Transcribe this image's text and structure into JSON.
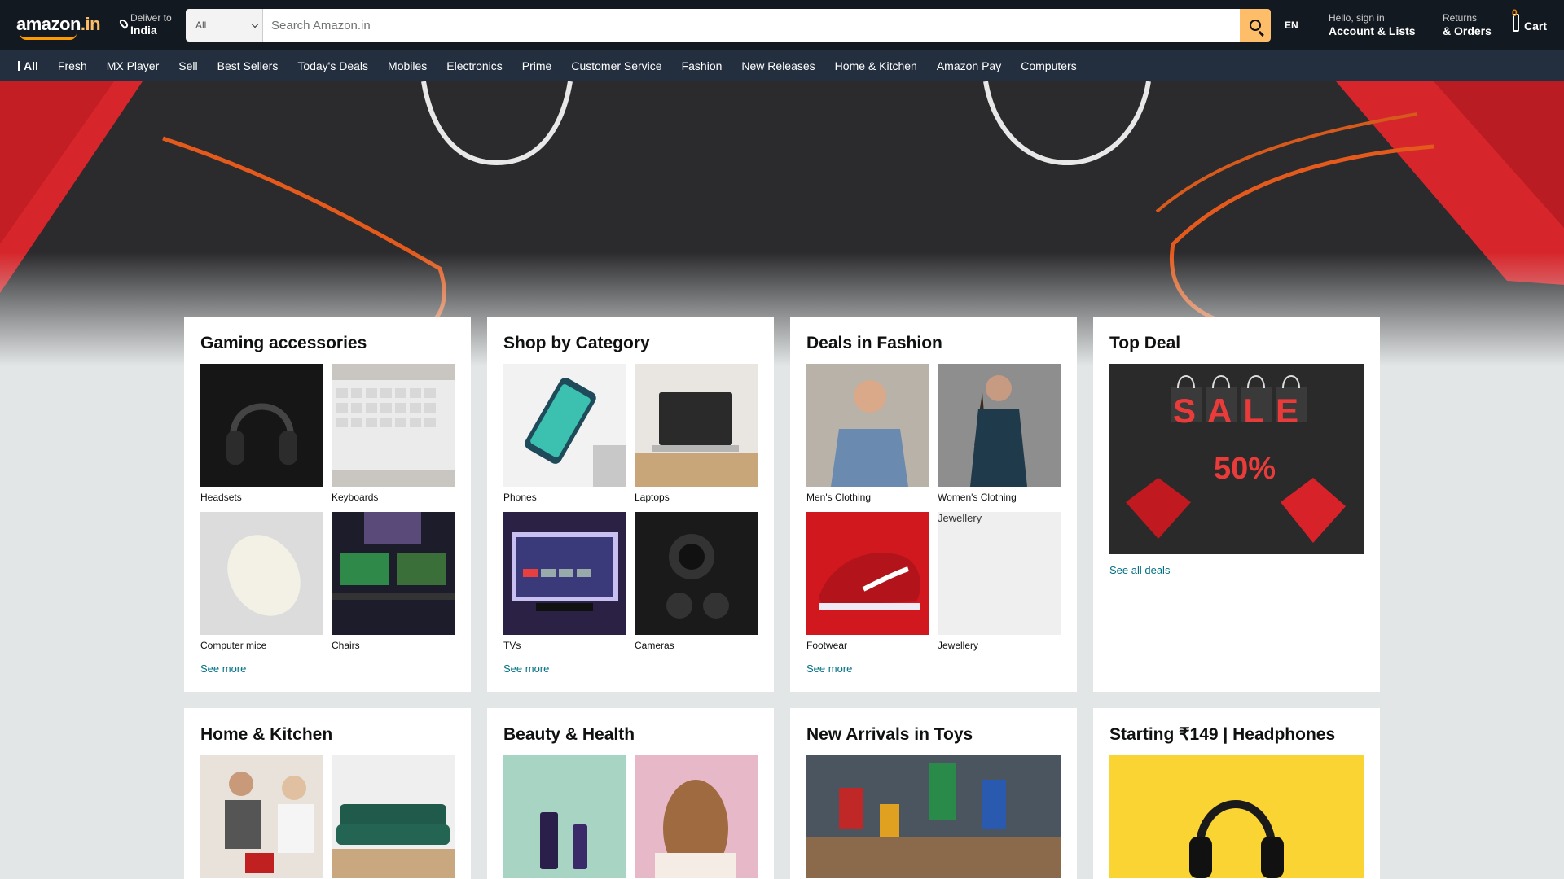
{
  "header": {
    "logo_main": "amazon",
    "logo_tld": ".in",
    "deliver_small": "Deliver to",
    "deliver_big": "India",
    "search_category": "All",
    "search_placeholder": "Search Amazon.in",
    "language": "EN",
    "account_small": "Hello, sign in",
    "account_big": "Account & Lists",
    "orders_small": "Returns",
    "orders_big": "& Orders",
    "cart_count": "0",
    "cart_label": "Cart"
  },
  "subnav": {
    "all": "All",
    "items": [
      "Fresh",
      "MX Player",
      "Sell",
      "Best Sellers",
      "Today's Deals",
      "Mobiles",
      "Electronics",
      "Prime",
      "Customer Service",
      "Fashion",
      "New Releases",
      "Home & Kitchen",
      "Amazon Pay",
      "Computers"
    ]
  },
  "cards": {
    "gaming": {
      "title": "Gaming accessories",
      "tiles": [
        "Headsets",
        "Keyboards",
        "Computer mice",
        "Chairs"
      ],
      "see_more": "See more"
    },
    "category": {
      "title": "Shop by Category",
      "tiles": [
        "Phones",
        "Laptops",
        "TVs",
        "Cameras"
      ],
      "see_more": "See more"
    },
    "fashion": {
      "title": "Deals in Fashion",
      "tiles": [
        "Men's Clothing",
        "Women's Clothing",
        "Footwear",
        "Jewellery"
      ],
      "broken_alt": "Jewellery",
      "see_more": "See more"
    },
    "topdeal": {
      "title": "Top Deal",
      "sale_text": "SALE",
      "discount_text": "50%",
      "link": "See all deals"
    },
    "home": {
      "title": "Home & Kitchen"
    },
    "beauty": {
      "title": "Beauty & Health"
    },
    "toys": {
      "title": "New Arrivals in Toys"
    },
    "headphones": {
      "title": "Starting ₹149 | Headphones"
    }
  }
}
